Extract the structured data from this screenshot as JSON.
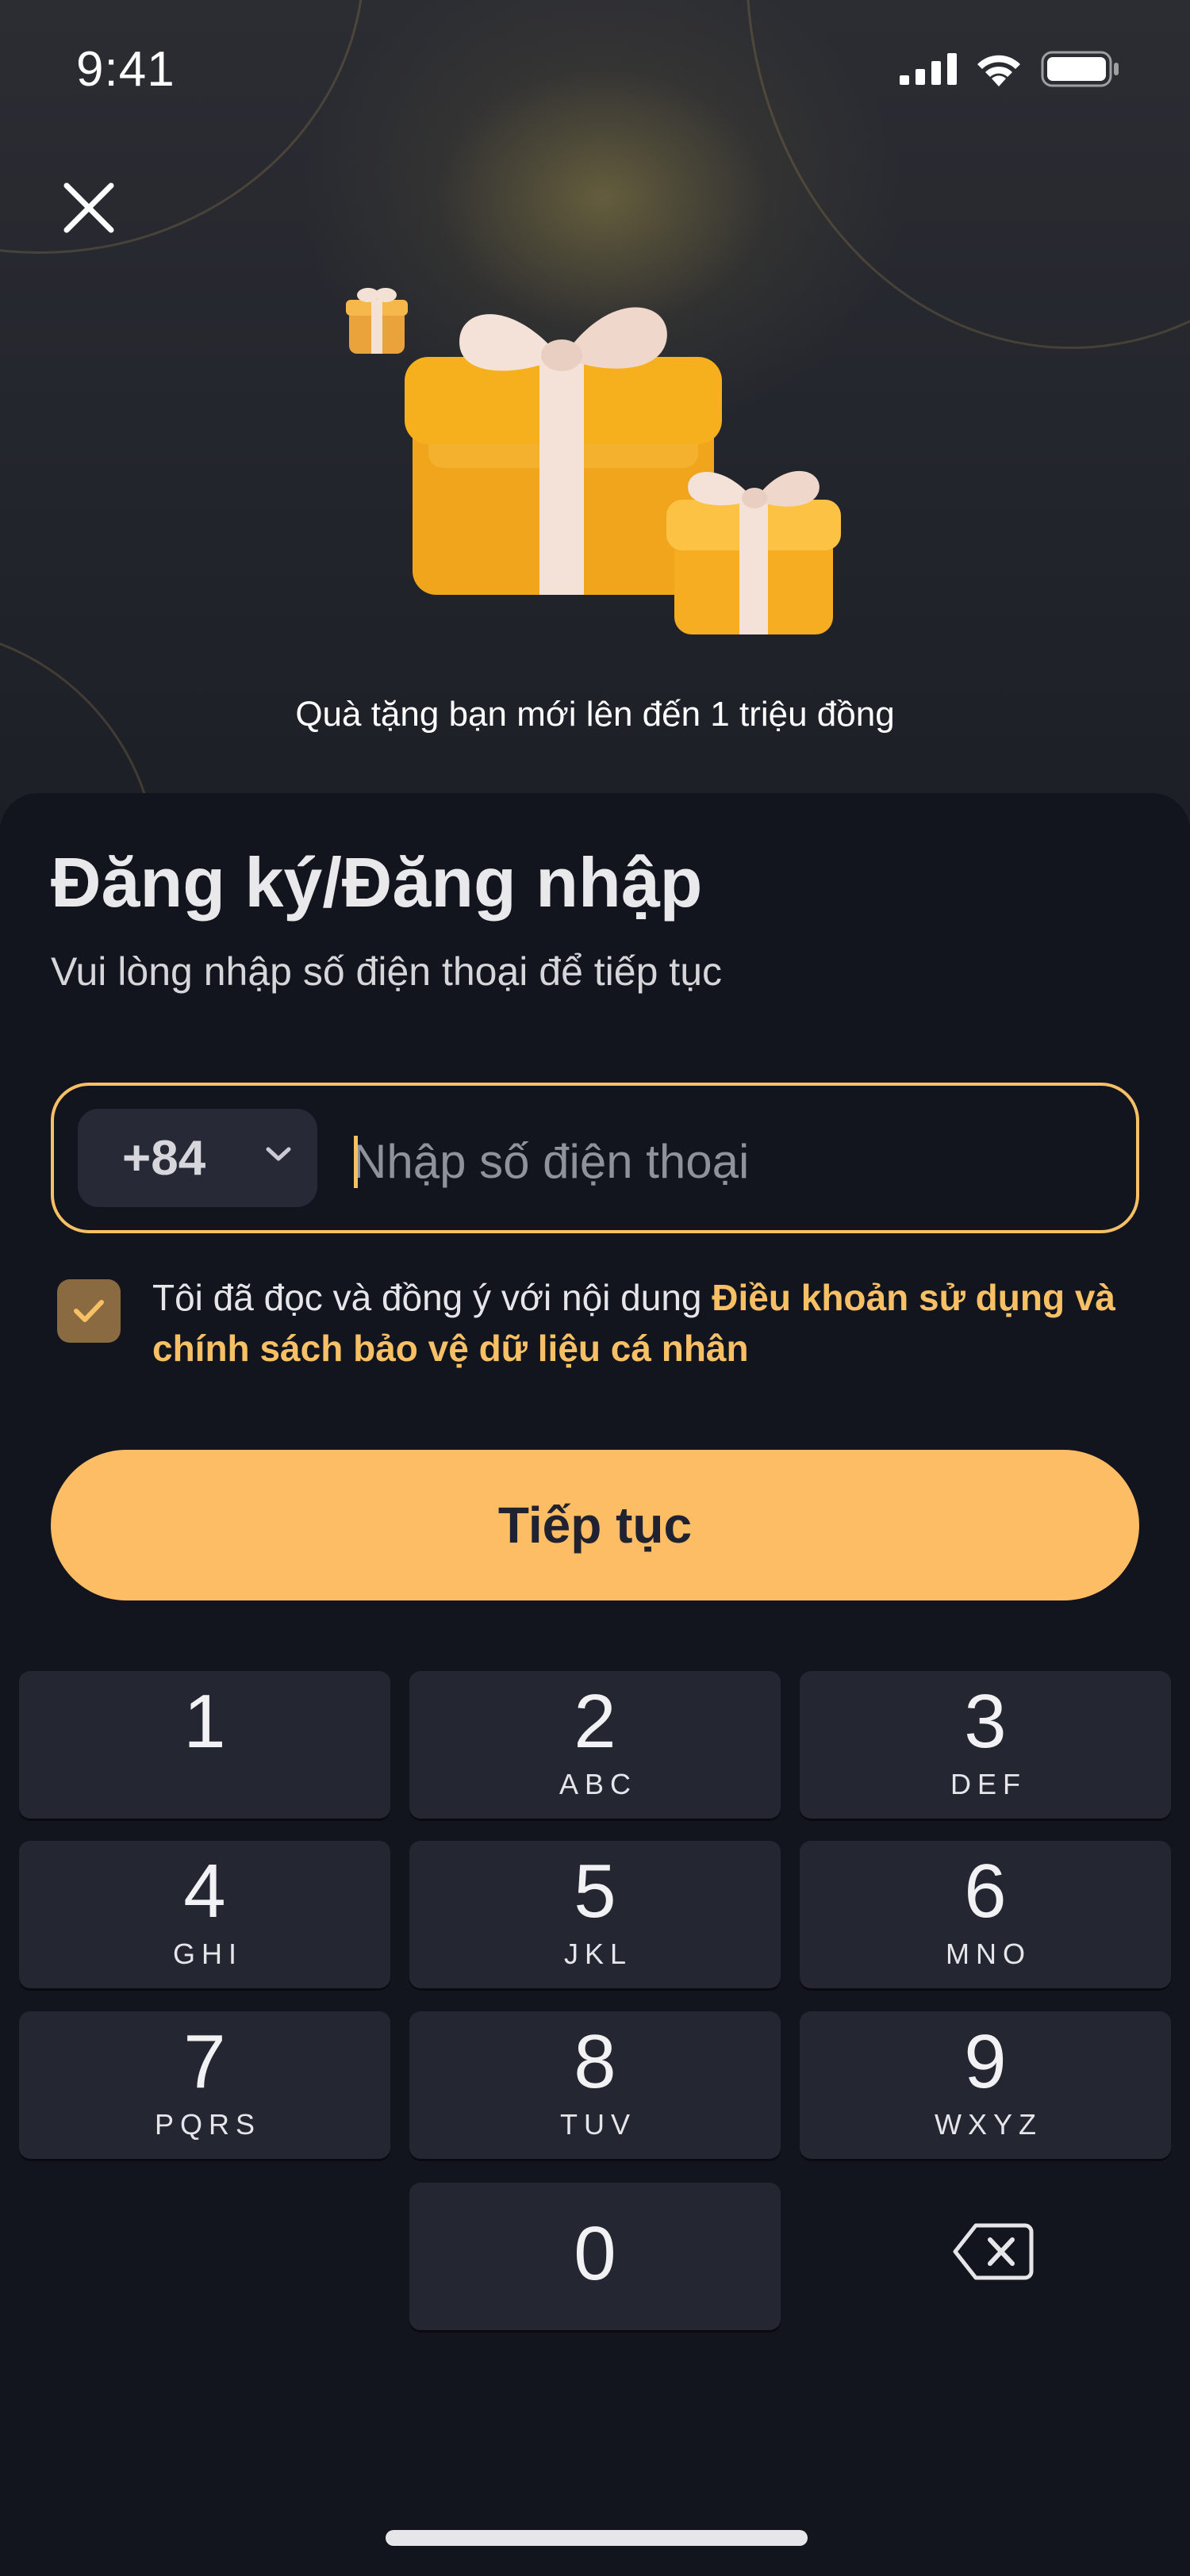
{
  "status_bar": {
    "time": "9:41",
    "icons": [
      "signal-icon",
      "wifi-icon",
      "battery-icon"
    ]
  },
  "header": {
    "close_icon": "close-icon"
  },
  "hero": {
    "promo_text": "Quà tặng bạn mới lên đến 1 triệu đồng",
    "illustration": "gift-boxes"
  },
  "login": {
    "title": "Đăng ký/Đăng nhập",
    "subtitle": "Vui lòng nhập số điện thoại để tiếp tục",
    "country_code": "+84",
    "phone_value": "",
    "phone_placeholder": "Nhập số điện thoại",
    "consent_checked": true,
    "consent_text": "Tôi đã đọc và đồng ý với nội dung ",
    "consent_link": "Điều khoản sử dụng và chính sách bảo vệ dữ liệu cá nhân",
    "continue_label": "Tiếp tục"
  },
  "keypad": {
    "keys": [
      {
        "digit": "1",
        "letters": ""
      },
      {
        "digit": "2",
        "letters": "ABC"
      },
      {
        "digit": "3",
        "letters": "DEF"
      },
      {
        "digit": "4",
        "letters": "GHI"
      },
      {
        "digit": "5",
        "letters": "JKL"
      },
      {
        "digit": "6",
        "letters": "MNO"
      },
      {
        "digit": "7",
        "letters": "PQRS"
      },
      {
        "digit": "8",
        "letters": "TUV"
      },
      {
        "digit": "9",
        "letters": "WXYZ"
      },
      {
        "digit": "0",
        "letters": ""
      }
    ],
    "backspace_icon": "backspace-icon"
  },
  "colors": {
    "accent": "#fdbd65",
    "background": "#13151e",
    "key": "#242731",
    "checkbox": "#8a6a40"
  }
}
